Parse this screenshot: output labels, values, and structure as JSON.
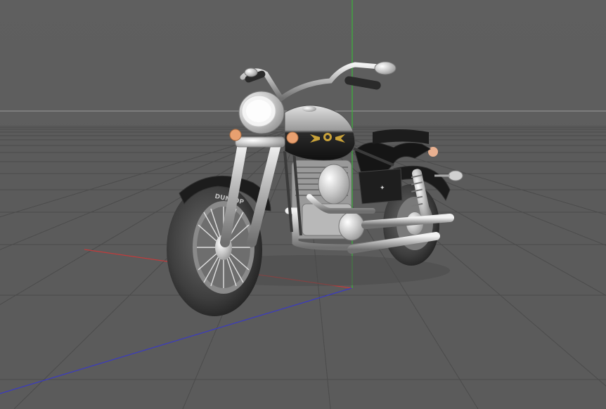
{
  "viewport": {
    "view": "perspective",
    "background_sky": "#5e5e5e",
    "background_floor": "#5c5c5c",
    "grid_color": "#4a4a4a",
    "horizon_line_color": "#9a9a9a"
  },
  "axes": {
    "x_axis_color": "#c23b3b",
    "y_axis_color": "#3bb53b",
    "z_axis_color": "#3a3ac2"
  },
  "scene": {
    "object": "motorcycle-model",
    "shading": "gray-clay",
    "tank_emblem_color": "#c9a23a",
    "turn_signal_color": "#e8a070",
    "tire_brand_text": "DUNLOP"
  }
}
